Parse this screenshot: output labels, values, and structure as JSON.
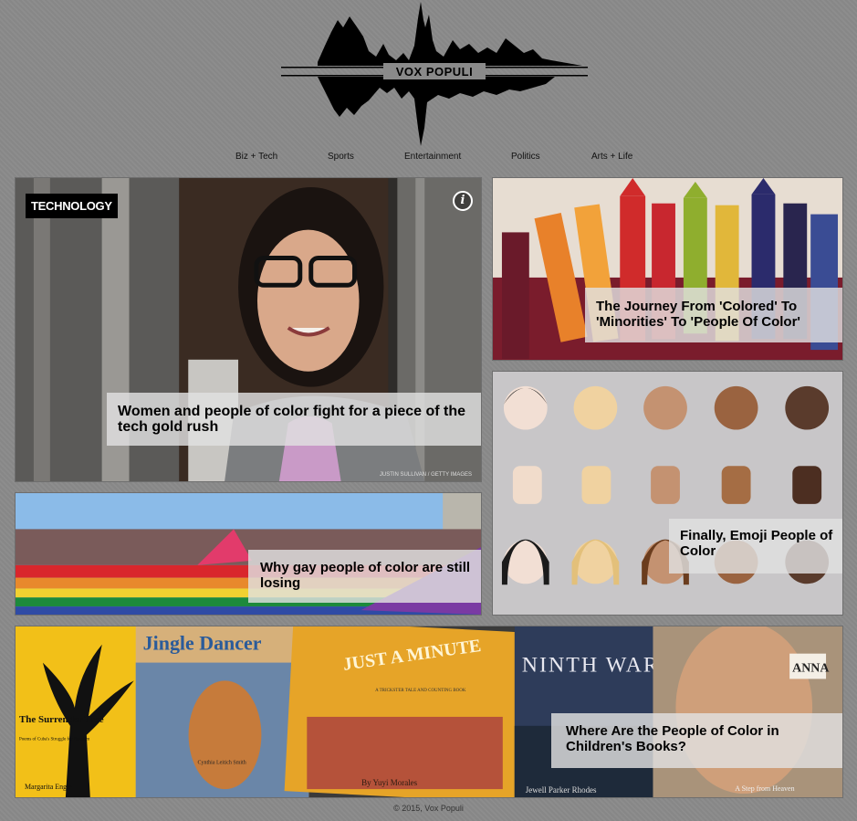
{
  "site": {
    "logo_text": "VOX POPULI"
  },
  "nav": {
    "items": [
      "Biz + Tech",
      "Sports",
      "Entertainment",
      "Politics",
      "Arts + Life"
    ]
  },
  "articles": {
    "tech": {
      "badge": "TECHNOLOGY",
      "title": "Women and people of color fight for a piece of the tech gold rush",
      "credit": "JUSTIN SULLIVAN / GETTY IMAGES"
    },
    "colored": {
      "title": "The Journey From 'Colored' To 'Minorities' To 'People Of Color'"
    },
    "gay": {
      "title": "Why gay people of color are still losing"
    },
    "emoji": {
      "title": "Finally, Emoji People of Color"
    },
    "books": {
      "title": "Where Are the People of Color in Children's Books?"
    }
  },
  "book_covers": {
    "surrender": "The Surrender Tree",
    "surrender_sub": "Poems of Cuba's Struggle for Freedom",
    "surrender_author": "Margarita Engle",
    "jingle": "Jingle Dancer",
    "jingle_author": "Cynthia Leitich Smith",
    "just": "JUST A MINUTE",
    "just_sub": "A TRICKSTER TALE AND COUNTING BOOK",
    "just_author": "By Yuyi Morales",
    "ninth": "NINTH WARD",
    "ninth_author": "Jewell Parker Rhodes",
    "anna": "ANNA",
    "anna_sub": "A Step from Heaven"
  },
  "footer": {
    "text": "© 2015, Vox Populi"
  },
  "colors": {
    "background": "#8a8a8a",
    "caption_bg": "#e1e1e1"
  }
}
